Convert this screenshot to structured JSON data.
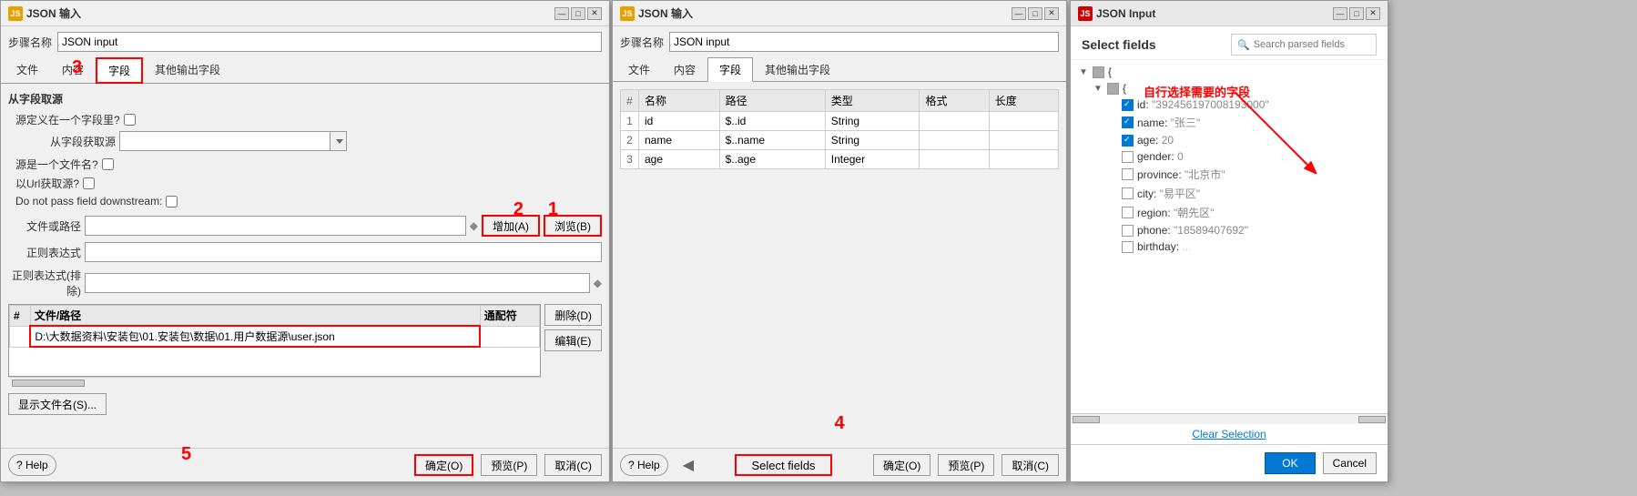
{
  "dialog1": {
    "title": "JSON 输入",
    "icon": "JS",
    "step_label": "步骤名称",
    "step_value": "JSON input",
    "tabs": [
      "文件",
      "内容",
      "字段",
      "其他输出字段"
    ],
    "active_tab_index": 2,
    "source_section_title": "从字段取源",
    "define_in_field_label": "源定义在一个字段里?",
    "get_from_field_label": "从字段获取源",
    "is_file_label": "源是一个文件名?",
    "use_url_label": "以Url获取源?",
    "no_pass_label": "Do not pass field downstream:",
    "file_path_label": "文件或路径",
    "regex_label": "正则表达式",
    "regex_exclude_label": "正则表达式(排除)",
    "table_headers": [
      "#",
      "文件/路径",
      "通配符"
    ],
    "table_rows": [
      {
        "num": "",
        "path": "D:\\大数据资料\\安装包\\01.安装包\\数据\\01.用户数据源\\user.json",
        "wildcard": ""
      }
    ],
    "show_filename_btn": "显示文件名(S)...",
    "add_btn": "增加(A)",
    "browse_btn": "浏览(B)",
    "delete_btn": "删除(D)",
    "edit_btn": "编辑(E)",
    "ok_btn": "确定(O)",
    "preview_btn": "预览(P)",
    "cancel_btn": "取消(C)",
    "help_btn": "? Help",
    "annotation_3": "3",
    "annotation_2": "2",
    "annotation_1": "1",
    "annotation_5": "5"
  },
  "dialog2": {
    "title": "JSON 输入",
    "icon": "JS",
    "step_label": "步骤名称",
    "step_value": "JSON input",
    "tabs": [
      "文件",
      "内容",
      "字段",
      "其他输出字段"
    ],
    "active_tab_index": 2,
    "table_headers": [
      "#",
      "名称",
      "路径",
      "类型",
      "格式",
      "长度"
    ],
    "table_rows": [
      {
        "num": "1",
        "name": "id",
        "path": "$..id",
        "type": "String",
        "format": "",
        "length": ""
      },
      {
        "num": "2",
        "name": "name",
        "path": "$..name",
        "type": "String",
        "format": "",
        "length": ""
      },
      {
        "num": "3",
        "name": "age",
        "path": "$..age",
        "type": "Integer",
        "format": "",
        "length": ""
      }
    ],
    "select_fields_btn": "Select fields",
    "ok_btn": "确定(O)",
    "preview_btn": "预览(P)",
    "cancel_btn": "取消(C)",
    "help_btn": "? Help",
    "annotation_4": "4"
  },
  "dialog3": {
    "title": "JSON Input",
    "icon": "JS",
    "header": "Select fields",
    "search_placeholder": "Search parsed fields",
    "tree": {
      "root1": "{",
      "root2": "{",
      "fields": [
        {
          "name": "id",
          "value": "\"392456197008193000\"",
          "checked": true
        },
        {
          "name": "name",
          "value": "\"张三\"",
          "checked": true
        },
        {
          "name": "age",
          "value": "20",
          "checked": true
        },
        {
          "name": "gender",
          "value": "0",
          "checked": false
        },
        {
          "name": "province",
          "value": "\"北京市\"",
          "checked": false
        },
        {
          "name": "city",
          "value": "\"易平区\"",
          "checked": false
        },
        {
          "name": "region",
          "value": "\"朝先区\"",
          "checked": false
        },
        {
          "name": "phone",
          "value": "\"18589407692\"",
          "checked": false
        },
        {
          "name": "birthday",
          "value": "...",
          "checked": false
        }
      ]
    },
    "clear_selection": "Clear Selection",
    "ok_btn": "OK",
    "cancel_btn": "Cancel",
    "annotation_text": "自行选择需要的字段",
    "min_btn": "—",
    "max_btn": "□",
    "close_btn": "✕"
  },
  "icons": {
    "minimize": "—",
    "maximize": "□",
    "close": "✕",
    "search": "🔍",
    "diamond": "◆"
  }
}
